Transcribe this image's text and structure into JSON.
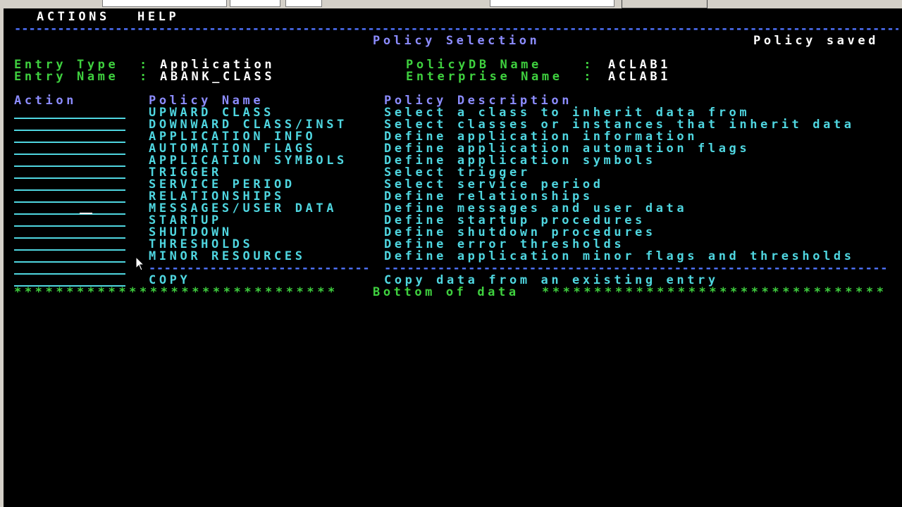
{
  "menu": {
    "actions": "ACTIONS",
    "help": "HELP"
  },
  "separator_top": "------------------------------------------------------------------------------------------------------------------------------------------------",
  "header": {
    "title": "Policy Selection",
    "status": "Policy saved"
  },
  "entry": {
    "type_label": "Entry Type  :",
    "type_value": "Application",
    "name_label": "Entry Name  :",
    "name_value": "ABANK_CLASS"
  },
  "db": {
    "policydb_label": "PolicyDB Name    :",
    "policydb_value": "ACLAB1",
    "enterprise_label": "Enterprise Name  :",
    "enterprise_value": "ACLAB1"
  },
  "columns": {
    "action": "Action",
    "name": "Policy Name",
    "description": "Policy Description"
  },
  "policies": [
    {
      "name": "UPWARD CLASS",
      "description": "Select a class to inherit data from"
    },
    {
      "name": "DOWNWARD CLASS/INST",
      "description": "Select classes or instances that inherit data"
    },
    {
      "name": "APPLICATION INFO",
      "description": "Define application information"
    },
    {
      "name": "AUTOMATION FLAGS",
      "description": "Define application automation flags"
    },
    {
      "name": "APPLICATION SYMBOLS",
      "description": "Define application symbols"
    },
    {
      "name": "TRIGGER",
      "description": "Select trigger"
    },
    {
      "name": "SERVICE PERIOD",
      "description": "Select service period"
    },
    {
      "name": "RELATIONSHIPS",
      "description": "Define relationships"
    },
    {
      "name": "MESSAGES/USER DATA",
      "description": "Define messages and user data"
    },
    {
      "name": "STARTUP",
      "description": "Define startup procedures"
    },
    {
      "name": "SHUTDOWN",
      "description": "Define shutdown procedures"
    },
    {
      "name": "THRESHOLDS",
      "description": "Define error thresholds"
    },
    {
      "name": "MINOR RESOURCES",
      "description": "Define application minor flags and thresholds"
    }
  ],
  "divider_name": "------------------------------",
  "divider_desc": "---------------------------------------------------------------------------------",
  "copy": {
    "name": "COPY",
    "description": "Copy data from an existing entry"
  },
  "bottom": {
    "left_stars": "*******************************",
    "text": "Bottom of data",
    "right_stars": "*********************************"
  },
  "colors": {
    "background": "#000000",
    "white": "#ffffff",
    "green": "#3fd13f",
    "cyan": "#4fd6e0",
    "blue": "#8c8cff",
    "dash_blue": "#4f73ff"
  }
}
